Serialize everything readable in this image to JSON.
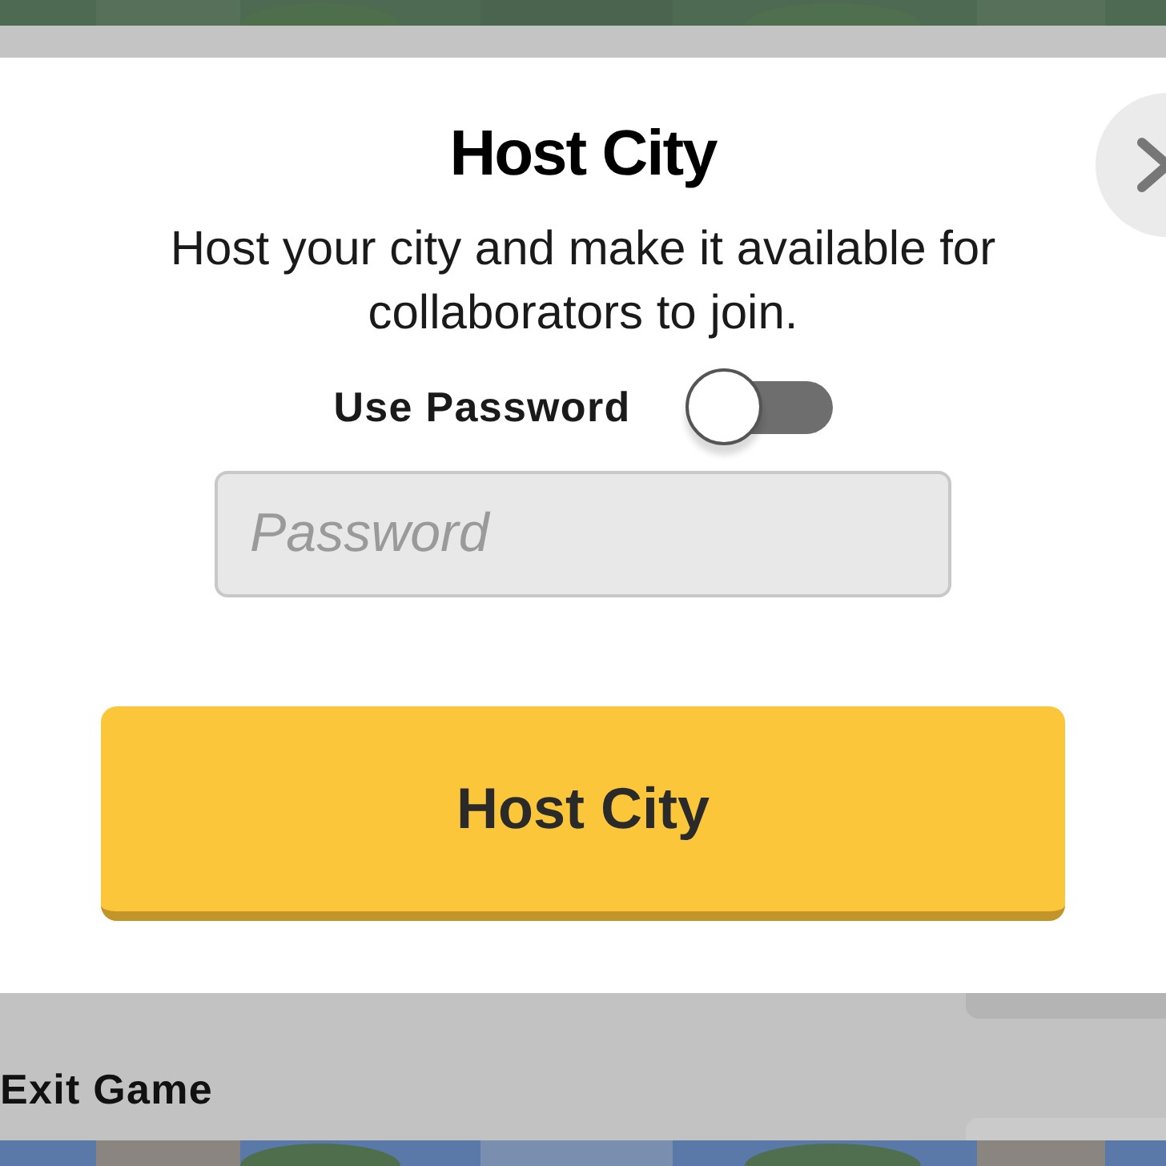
{
  "dialog": {
    "title": "Host City",
    "description": "Host your city and make it available for collaborators to join.",
    "password_toggle": {
      "label": "Use Password",
      "on": false
    },
    "password_field": {
      "placeholder": "Password"
    },
    "primary_button": "Host City"
  },
  "bottom_bar": {
    "exit_button": "Exit Game"
  }
}
